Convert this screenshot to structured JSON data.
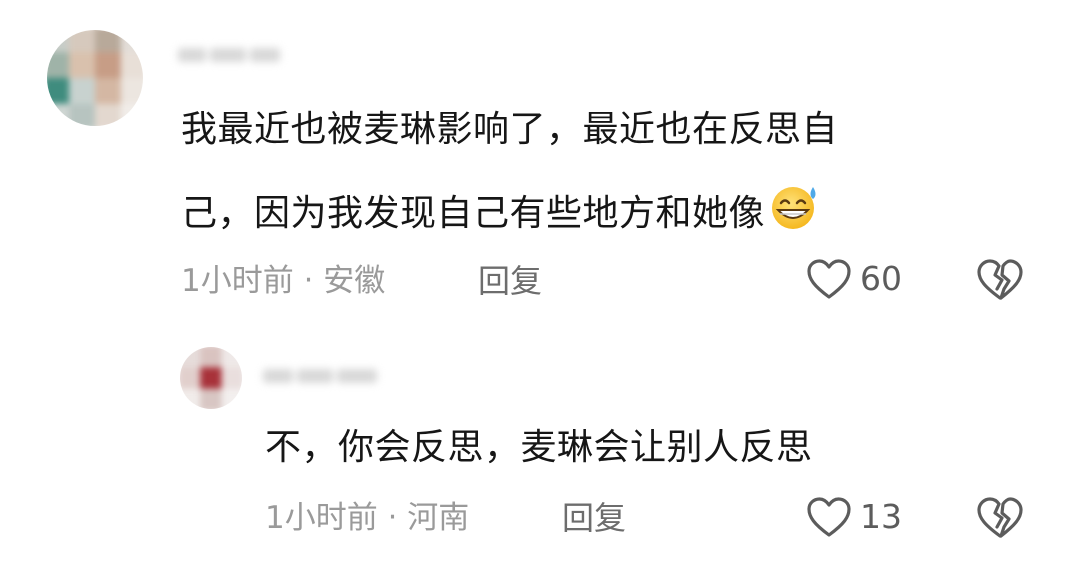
{
  "comments": [
    {
      "text_line1": "我最近也被麦琳影响了，最近也在反思自",
      "text_line2": "己，因为我发现自己有些地方和她像",
      "emoji": "grinning-face-with-sweat",
      "time": "1小时前",
      "separator": "·",
      "location": "安徽",
      "reply_label": "回复",
      "likes": "60"
    },
    {
      "text_line1": "不，你会反思，麦琳会让别人反思",
      "time": "1小时前",
      "separator": "·",
      "location": "河南",
      "reply_label": "回复",
      "likes": "13"
    }
  ],
  "icons": {
    "like": "heart-outline-icon",
    "dislike": "broken-heart-icon"
  },
  "colors": {
    "text": "#161616",
    "meta": "#9a9a9a",
    "reply": "#6d6d6d",
    "icon": "#5c5c5c"
  }
}
